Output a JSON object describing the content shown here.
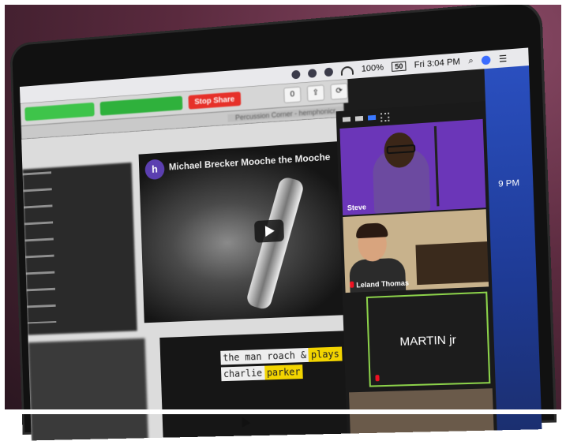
{
  "menubar": {
    "battery": "100%",
    "battery_badge": "50",
    "time": "Fri 3:04 PM"
  },
  "browser": {
    "stop_share_label": "Stop Share",
    "toolbar_badge": "0",
    "tabs": [
      "Percussion Corner - hemphonicr"
    ]
  },
  "video": {
    "logo_letter": "h",
    "title": "Michael Brecker Mooche the Mooche"
  },
  "video2": {
    "lines": [
      {
        "text": "the man roach & ",
        "hl": "plays"
      },
      {
        "text": "charlie ",
        "hl": "parker"
      }
    ]
  },
  "zoom": {
    "participants": [
      {
        "name": "Steve"
      },
      {
        "name": "Leland Thomas"
      },
      {
        "name": "MARTIN jr"
      }
    ]
  },
  "desktop": {
    "time_fragment": "9 PM"
  }
}
